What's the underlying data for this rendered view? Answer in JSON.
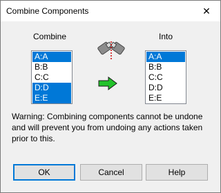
{
  "window": {
    "title": "Combine Components",
    "close_glyph": "✕"
  },
  "combine": {
    "heading": "Combine",
    "items": [
      {
        "label": "A:A",
        "selected": true
      },
      {
        "label": "B:B",
        "selected": false
      },
      {
        "label": "C:C",
        "selected": false
      },
      {
        "label": "D:D",
        "selected": true
      },
      {
        "label": "E:E",
        "selected": true
      }
    ]
  },
  "into": {
    "heading": "Into",
    "items": [
      {
        "label": "A:A",
        "selected": true
      },
      {
        "label": "B:B",
        "selected": false
      },
      {
        "label": "C:C",
        "selected": false
      },
      {
        "label": "D:D",
        "selected": false
      },
      {
        "label": "E:E",
        "selected": false
      }
    ]
  },
  "icons": {
    "combine_icon": "combine-components-icon",
    "arrow_icon": "green-right-arrow-icon"
  },
  "colors": {
    "selection": "#0078d7",
    "arrow": "#22c22a"
  },
  "warning": "Warning: Combining components cannot be undone and will prevent you from undoing any actions taken prior to this.",
  "buttons": {
    "ok": "OK",
    "cancel": "Cancel",
    "help": "Help"
  }
}
